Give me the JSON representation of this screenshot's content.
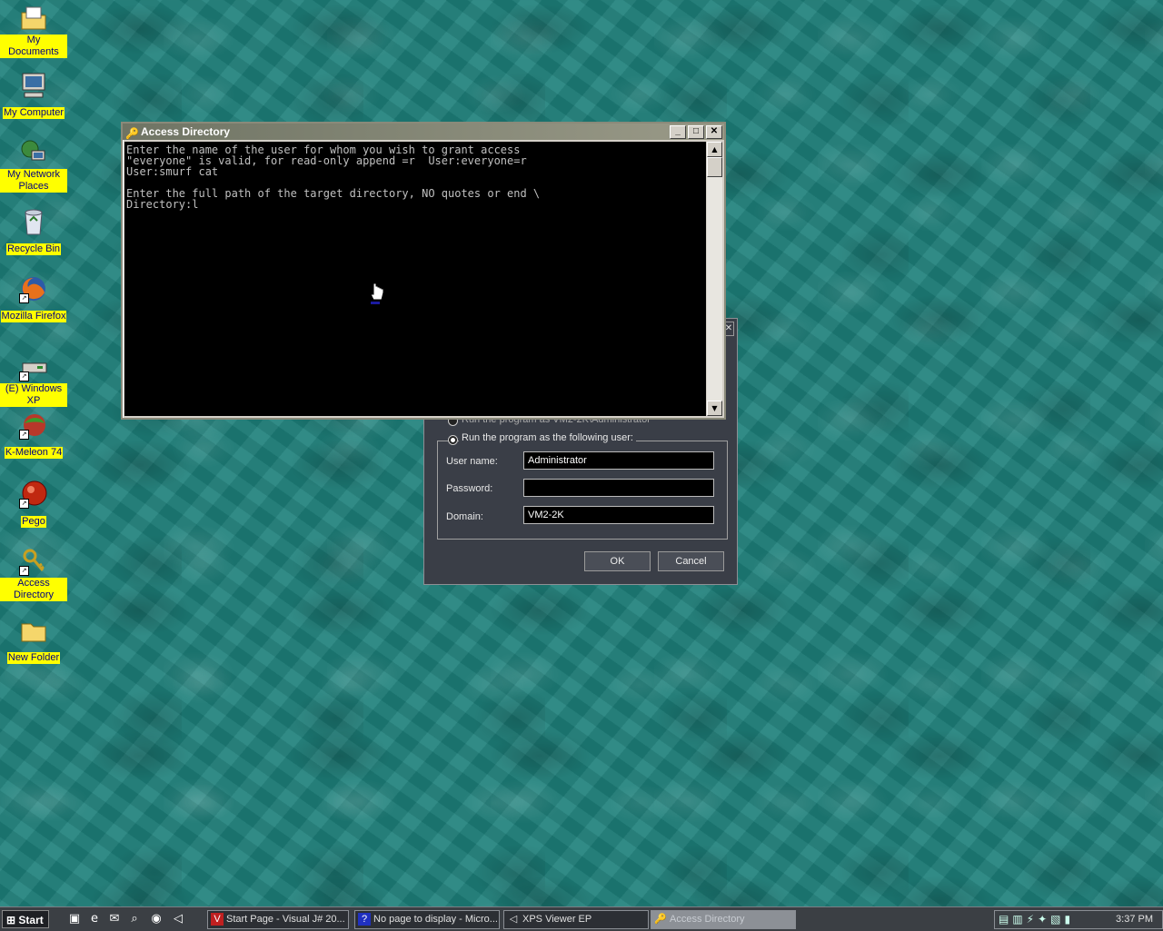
{
  "desktop": {
    "icons": [
      {
        "label": "My Documents",
        "glyph": "folder-docs-icon"
      },
      {
        "label": "My Computer",
        "glyph": "computer-icon"
      },
      {
        "label": "My Network Places",
        "glyph": "network-icon"
      },
      {
        "label": "Recycle Bin",
        "glyph": "recycle-bin-icon"
      },
      {
        "label": "Mozilla Firefox",
        "glyph": "firefox-icon"
      },
      {
        "label": "(E) Windows XP",
        "glyph": "drive-icon"
      },
      {
        "label": "K-Meleon 74",
        "glyph": "kmeleon-icon"
      },
      {
        "label": "Pego",
        "glyph": "pego-icon"
      },
      {
        "label": "Access Directory",
        "glyph": "keys-icon"
      },
      {
        "label": "New Folder",
        "glyph": "folder-icon"
      }
    ]
  },
  "console": {
    "title": "Access Directory",
    "text": "Enter the name of the user for whom you wish to grant access\n\"everyone\" is valid, for read-only append =r  User:everyone=r\nUser:smurf cat\n\nEnter the full path of the target directory, NO quotes or end \\\nDirectory:l"
  },
  "runas": {
    "hidden_option": "Run the program as VM2-2K\\Administrator",
    "following_user_label": "Run the program as the following user:",
    "username_label": "User name:",
    "username_value": "Administrator",
    "password_label": "Password:",
    "password_value": "",
    "domain_label": "Domain:",
    "domain_value": "VM2-2K",
    "ok_label": "OK",
    "cancel_label": "Cancel"
  },
  "taskbar": {
    "start_label": "Start",
    "tasks": [
      {
        "label": "Start Page - Visual J# 20...",
        "icon": "vs-icon"
      },
      {
        "label": "No page to display - Micro...",
        "icon": "help-icon"
      },
      {
        "label": "XPS Viewer EP",
        "icon": "xps-icon"
      },
      {
        "label": "Access Directory",
        "icon": "keys-icon"
      }
    ],
    "clock": "3:37 PM"
  }
}
